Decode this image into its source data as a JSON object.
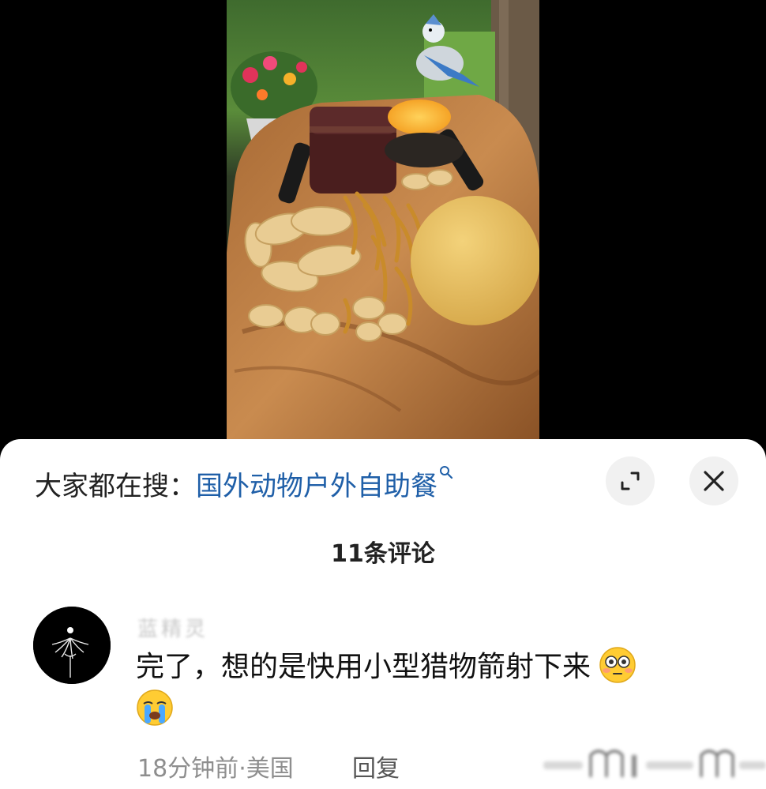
{
  "search": {
    "prefix": "大家都在搜：",
    "term": "国外动物户外自助餐"
  },
  "comments_header": {
    "count_label": "11条评论"
  },
  "comment": {
    "username": "蓝精灵",
    "text": "完了，想的是快用小型猎物箭射下来",
    "emojis": [
      "flushed-face-emoji",
      "loudly-crying-face-emoji"
    ],
    "time": "18分钟前",
    "location": "美国",
    "reply_label": "回复"
  },
  "icons": {
    "expand": "expand-icon",
    "close": "close-icon",
    "search": "search-icon"
  },
  "colors": {
    "link": "#1f5fa8",
    "sheet_bg": "#ffffff",
    "page_bg": "#000000"
  }
}
